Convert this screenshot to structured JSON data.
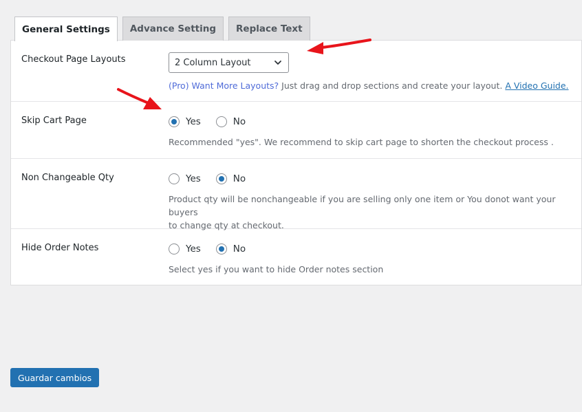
{
  "tabs": [
    {
      "label": "General Settings",
      "active": true
    },
    {
      "label": "Advance Setting",
      "active": false
    },
    {
      "label": "Replace Text",
      "active": false
    }
  ],
  "rows": {
    "layouts": {
      "label": "Checkout Page Layouts",
      "select_value": "2 Column Layout",
      "pro_text": "(Pro) Want More Layouts?",
      "desc_text": " Just drag and drop sections and create your layout. ",
      "link_text": "A Video Guide."
    },
    "skip_cart": {
      "label": "Skip Cart Page",
      "yes": "Yes",
      "no": "No",
      "selected": "yes",
      "desc": "Recommended \"yes\". We recommend to skip cart page to shorten the checkout process ."
    },
    "non_changeable_qty": {
      "label": "Non Changeable Qty",
      "yes": "Yes",
      "no": "No",
      "selected": "no",
      "desc_line1": "Product qty will be nonchangeable if you are selling only one item or You donot want your buyers",
      "desc_line2": "to change qty at checkout."
    },
    "hide_order_notes": {
      "label": "Hide Order Notes",
      "yes": "Yes",
      "no": "No",
      "selected": "no",
      "desc": "Select yes if you want to hide Order notes section"
    }
  },
  "save_button": "Guardar cambios",
  "colors": {
    "primary": "#2271b1",
    "annotation_arrow": "#e8141b",
    "background": "#f0f0f1"
  },
  "icons": {
    "select_caret": "chevron-down-icon",
    "annotation": "red-arrow-icon"
  }
}
